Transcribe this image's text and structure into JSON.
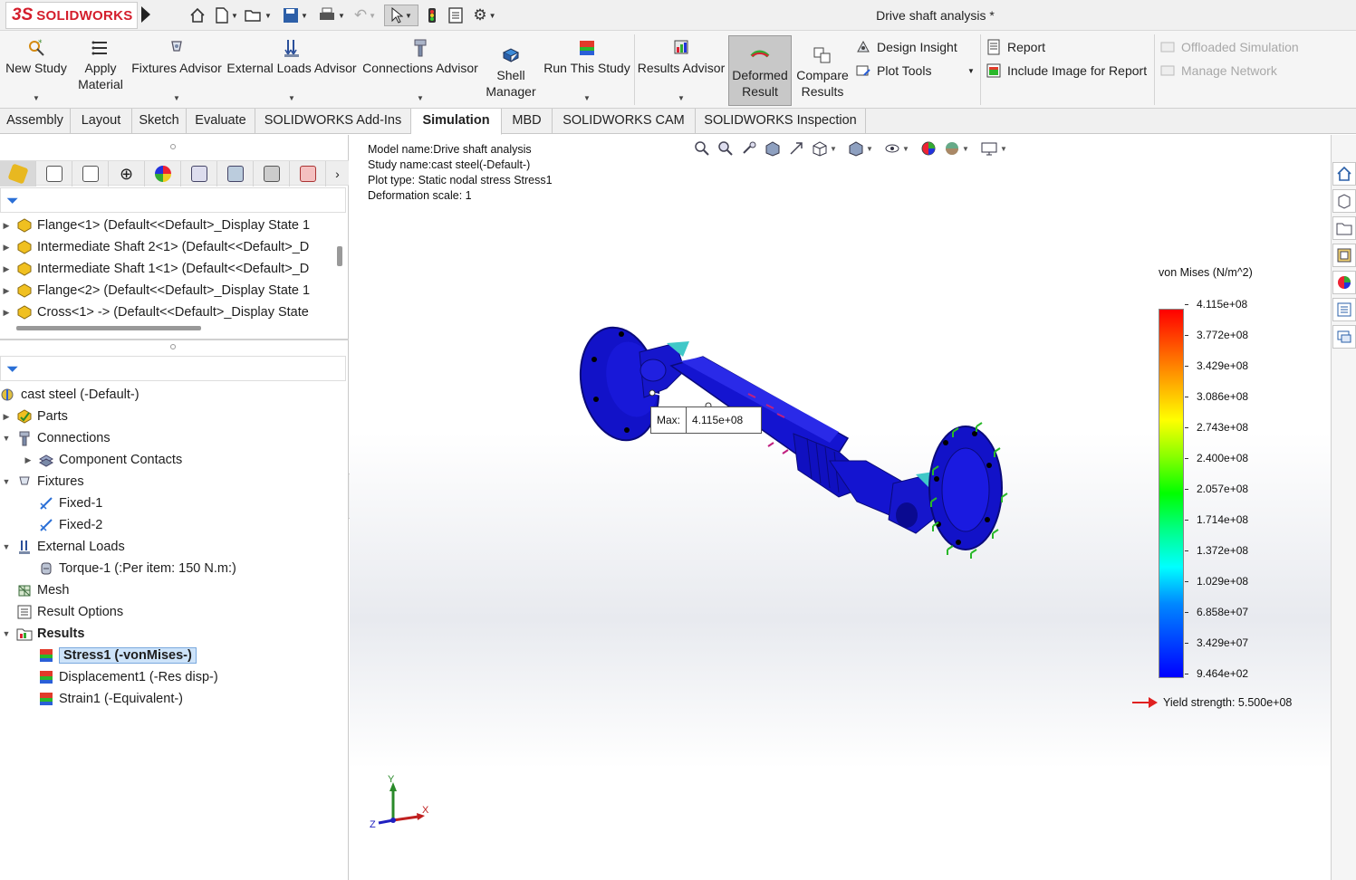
{
  "window": {
    "title": "Drive shaft analysis *",
    "logo_ds": "3S",
    "logo_text": "SOLIDWORKS"
  },
  "ribbon": {
    "new_study": "New Study",
    "apply_material_1": "Apply",
    "apply_material_2": "Material",
    "fixtures_advisor": "Fixtures Advisor",
    "external_loads_advisor": "External Loads Advisor",
    "connections_advisor": "Connections Advisor",
    "shell_manager_1": "Shell",
    "shell_manager_2": "Manager",
    "run_this_study": "Run This Study",
    "results_advisor": "Results Advisor",
    "deformed_result_1": "Deformed",
    "deformed_result_2": "Result",
    "compare_results_1": "Compare",
    "compare_results_2": "Results",
    "design_insight": "Design Insight",
    "plot_tools": "Plot Tools",
    "report": "Report",
    "include_image": "Include Image for Report",
    "offloaded_simulation": "Offloaded Simulation",
    "manage_network": "Manage Network"
  },
  "tabs": [
    "Assembly",
    "Layout",
    "Sketch",
    "Evaluate",
    "SOLIDWORKS Add-Ins",
    "Simulation",
    "MBD",
    "SOLIDWORKS CAM",
    "SOLIDWORKS Inspection"
  ],
  "active_tab": "Simulation",
  "feature_tree": {
    "items": [
      "Flange<1> (Default<<Default>_Display State 1",
      "Intermediate Shaft 2<1> (Default<<Default>_D",
      "Intermediate Shaft 1<1> (Default<<Default>_D",
      "Flange<2> (Default<<Default>_Display State 1",
      "Cross<1> -> (Default<<Default>_Display State"
    ]
  },
  "study_tree": {
    "root": "cast steel (-Default-)",
    "parts": "Parts",
    "connections": "Connections",
    "component_contacts": "Component Contacts",
    "fixtures": "Fixtures",
    "fixed1": "Fixed-1",
    "fixed2": "Fixed-2",
    "external_loads": "External Loads",
    "torque1": "Torque-1 (:Per item: 150 N.m:)",
    "mesh": "Mesh",
    "result_options": "Result Options",
    "results": "Results",
    "stress1": "Stress1 (-vonMises-)",
    "displacement1": "Displacement1 (-Res disp-)",
    "strain1": "Strain1 (-Equivalent-)"
  },
  "viewport": {
    "model_name": "Model name:Drive shaft analysis",
    "study_name": "Study name:cast steel(-Default-)",
    "plot_type": "Plot type: Static nodal stress Stress1",
    "deformation_scale": "Deformation scale: 1",
    "max_label": "Max:",
    "max_value": "4.115e+08",
    "triad_x": "X",
    "triad_y": "Y",
    "triad_z": "Z"
  },
  "legend": {
    "title": "von Mises (N/m^2)",
    "values": [
      "4.115e+08",
      "3.772e+08",
      "3.429e+08",
      "3.086e+08",
      "2.743e+08",
      "2.400e+08",
      "2.057e+08",
      "1.714e+08",
      "1.372e+08",
      "1.029e+08",
      "6.858e+07",
      "3.429e+07",
      "9.464e+02"
    ],
    "yield": "Yield strength: 5.500e+08",
    "colors": {
      "max": "#ff0000",
      "min": "#0000ff",
      "yield_arrow": "#e02020"
    }
  },
  "model_color": "#1010d8"
}
